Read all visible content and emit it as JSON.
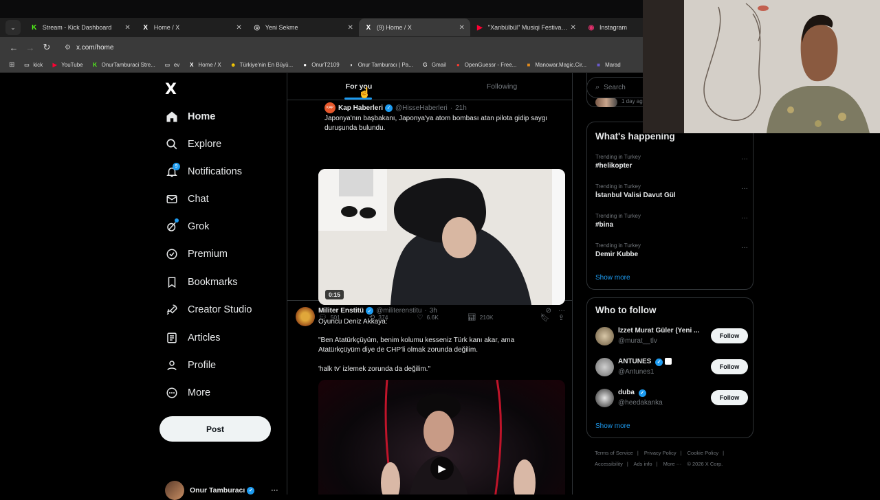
{
  "browser": {
    "tabs": [
      {
        "label": "Stream - Kick Dashboard",
        "icon": "kick-icon",
        "icon_color": "#53fc18",
        "icon_char": "K",
        "active": false
      },
      {
        "label": "Home / X",
        "icon": "x-icon",
        "icon_color": "#ffffff",
        "icon_char": "𝕏",
        "active": false
      },
      {
        "label": "Yeni Sekme",
        "icon": "chrome-icon",
        "icon_color": "#cccccc",
        "icon_char": "◎",
        "active": false
      },
      {
        "label": "(9) Home / X",
        "icon": "x-icon",
        "icon_color": "#ffffff",
        "icon_char": "𝕏",
        "active": true
      },
      {
        "label": "\"Xanbülbül\" Musiqi Festivalı İl...",
        "icon": "youtube-icon",
        "icon_color": "#ff0033",
        "icon_char": "▶",
        "active": false
      },
      {
        "label": "Instagram",
        "icon": "instagram-icon",
        "icon_color": "#e1306c",
        "icon_char": "◉",
        "active": false
      }
    ],
    "url": "x.com/home",
    "bookmarks": [
      {
        "label": "kick",
        "icon": "folder-icon",
        "icon_color": "#bbbbbb",
        "icon_char": "▭"
      },
      {
        "label": "YouTube",
        "icon": "youtube-icon",
        "icon_color": "#ff0033",
        "icon_char": "▶"
      },
      {
        "label": "OnurTamburaci Stre...",
        "icon": "kick-icon",
        "icon_color": "#53fc18",
        "icon_char": "K"
      },
      {
        "label": "ev",
        "icon": "folder-icon",
        "icon_color": "#bbbbbb",
        "icon_char": "▭"
      },
      {
        "label": "Home / X",
        "icon": "x-icon",
        "icon_color": "#ffffff",
        "icon_char": "𝕏"
      },
      {
        "label": "Türkiye'nin En Büyü...",
        "icon": "sahibinden-icon",
        "icon_color": "#ffd000",
        "icon_char": "☻"
      },
      {
        "label": "OnurT2109",
        "icon": "github-icon",
        "icon_color": "#ffffff",
        "icon_char": "●"
      },
      {
        "label": "Onur Tamburacı | Pa...",
        "icon": "patreon-icon",
        "icon_color": "#ffffff",
        "icon_char": "◗"
      },
      {
        "label": "Gmail",
        "icon": "google-icon",
        "icon_color": "#dddddd",
        "icon_char": "G"
      },
      {
        "label": "OpenGuessr - Free...",
        "icon": "openguessr-icon",
        "icon_color": "#ff3b30",
        "icon_char": "●"
      },
      {
        "label": "Manowar.Magic.Cir...",
        "icon": "bookmark-site-icon",
        "icon_color": "#e08a1e",
        "icon_char": "■"
      },
      {
        "label": "Marad",
        "icon": "bookmark-site-icon",
        "icon_color": "#6a5acd",
        "icon_char": "■"
      }
    ]
  },
  "nav": {
    "items": [
      {
        "label": "Home",
        "icon": "home-icon"
      },
      {
        "label": "Explore",
        "icon": "search-icon"
      },
      {
        "label": "Notifications",
        "icon": "bell-icon",
        "badge": "9"
      },
      {
        "label": "Chat",
        "icon": "mail-icon"
      },
      {
        "label": "Grok",
        "icon": "grok-icon"
      },
      {
        "label": "Premium",
        "icon": "verified-icon"
      },
      {
        "label": "Bookmarks",
        "icon": "bookmark-icon"
      },
      {
        "label": "Creator Studio",
        "icon": "rocket-icon"
      },
      {
        "label": "Articles",
        "icon": "article-icon"
      },
      {
        "label": "Profile",
        "icon": "person-icon"
      },
      {
        "label": "More",
        "icon": "more-circle-icon"
      }
    ],
    "post_label": "Post",
    "account_name": "Onur Tamburacı"
  },
  "feed": {
    "tabs": [
      "For you",
      "Following"
    ],
    "posts": [
      {
        "name": "Kap Haberleri",
        "handle": "@HisseHaberleri",
        "time": "21h",
        "text": "Japonya'nın başbakanı, Japonya'ya atom bombası atan pilota gidip saygı duruşunda bulundu.",
        "video_duration": "0:15",
        "replies": "501",
        "reposts": "374",
        "likes": "6.6K",
        "views": "210K"
      },
      {
        "name": "Militer Enstitü",
        "handle": "@militerenstitu",
        "time": "3h",
        "text_line1": "Oyuncu Deniz Akkaya:",
        "text_quote": "\"Ben Atatürkçüyüm, benim kolumu kesseniz Türk kanı akar, ama Atatürkçüyüm diye de CHP'li olmak zorunda değilim.",
        "text_line3": "'halk tv' izlemek zorunda da değilim.\""
      }
    ]
  },
  "sidebar": {
    "search_placeholder": "Search",
    "snippet": "1 day ago",
    "happening_title": "What's happening",
    "trends": [
      {
        "meta": "Trending in Turkey",
        "topic": "#helikopter"
      },
      {
        "meta": "Trending in Turkey",
        "topic": "İstanbul Valisi Davut Gül"
      },
      {
        "meta": "Trending in Turkey",
        "topic": "#bina"
      },
      {
        "meta": "Trending in Turkey",
        "topic": "Demir Kubbe"
      }
    ],
    "show_more": "Show more",
    "wtf_title": "Who to follow",
    "who_to_follow": [
      {
        "name": "İzzet Murat Güler (Yeni ...",
        "handle": "@murat__tlv"
      },
      {
        "name": "ANTUNES",
        "handle": "@Antunes1"
      },
      {
        "name": "duba",
        "handle": "@heedakanka"
      }
    ],
    "follow_label": "Follow",
    "footer": [
      "Terms of Service",
      "|",
      "Privacy Policy",
      "|",
      "Cookie Policy",
      "|",
      "Accessibility",
      "|",
      "Ads info",
      "|",
      "More ···",
      "© 2026 X Corp."
    ]
  },
  "colors": {
    "accent": "#1d9bf0",
    "background": "#000000",
    "border": "#2f3336"
  }
}
